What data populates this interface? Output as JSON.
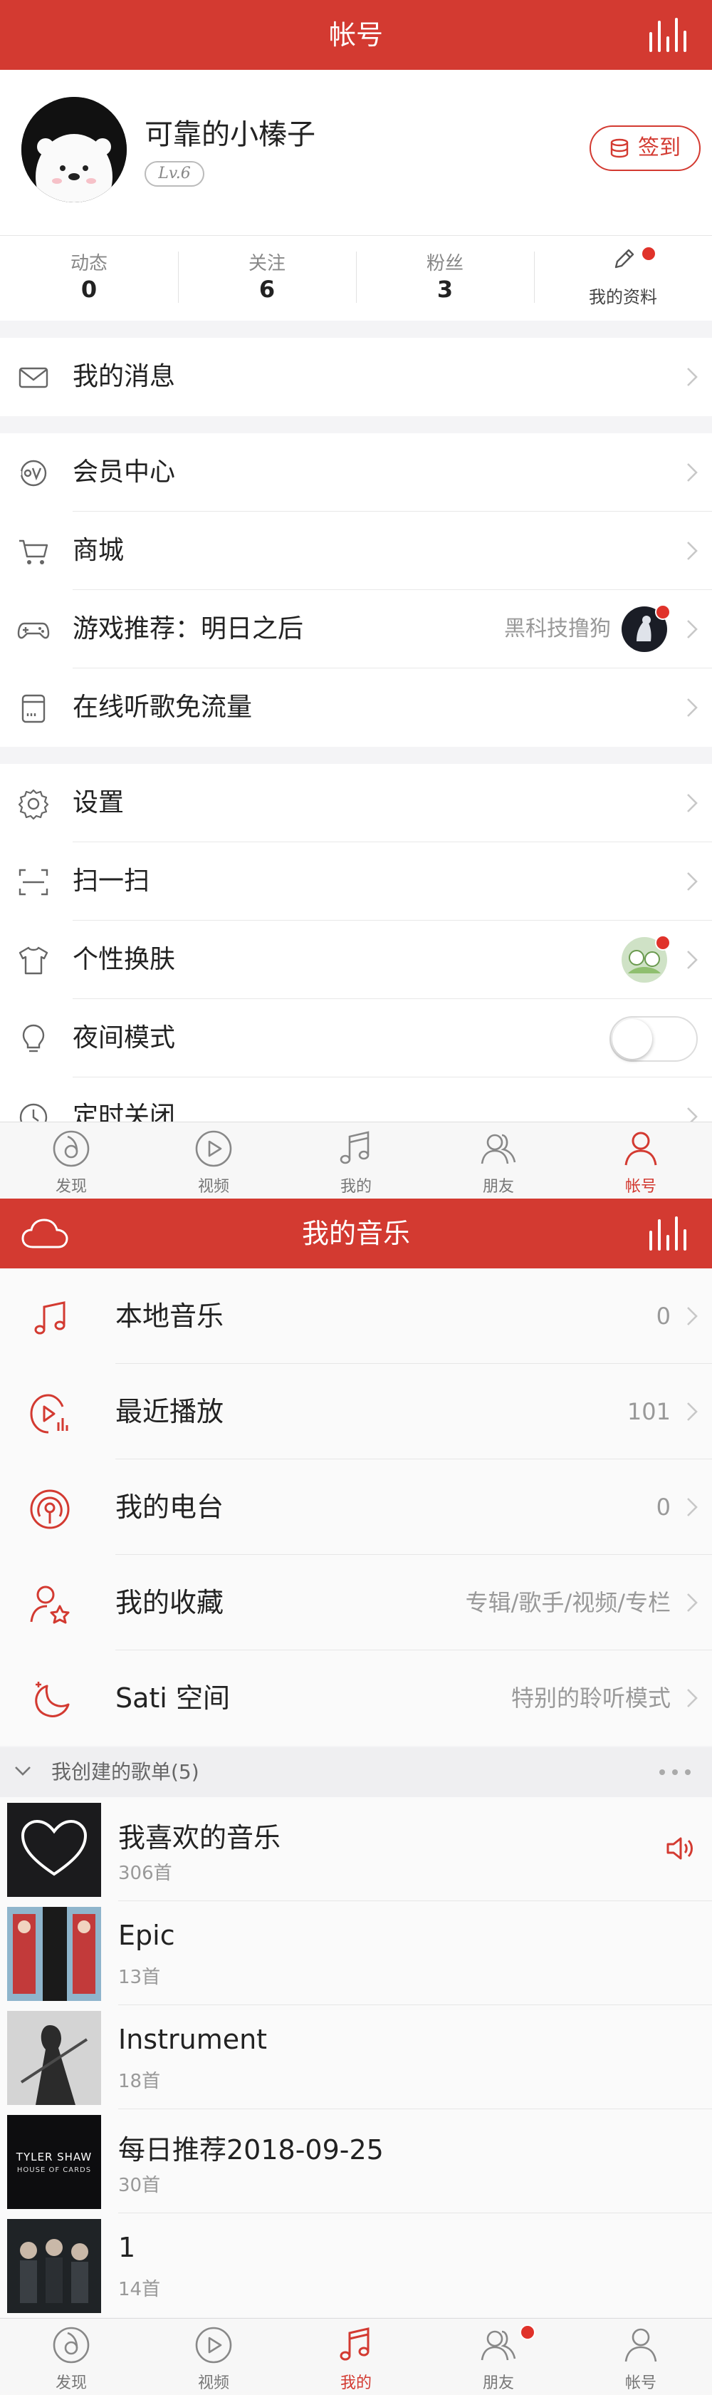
{
  "account": {
    "header": {
      "title": "帐号"
    },
    "profile": {
      "username": "可靠的小榛子",
      "level": "Lv.6",
      "signin_label": "签到"
    },
    "stats": [
      {
        "label": "动态",
        "value": "0"
      },
      {
        "label": "关注",
        "value": "6"
      },
      {
        "label": "粉丝",
        "value": "3"
      },
      {
        "label": "我的资料"
      }
    ],
    "group1": [
      {
        "label": "我的消息",
        "icon": "mail-icon"
      }
    ],
    "group2": [
      {
        "label": "会员中心",
        "icon": "vip-icon"
      },
      {
        "label": "商城",
        "icon": "cart-icon"
      },
      {
        "label": "游戏推荐：明日之后",
        "sub": "黑科技撸狗",
        "icon": "gamepad-icon"
      },
      {
        "label": "在线听歌免流量",
        "icon": "sim-card-icon"
      }
    ],
    "group3": [
      {
        "label": "设置",
        "icon": "gear-icon"
      },
      {
        "label": "扫一扫",
        "icon": "scan-icon"
      },
      {
        "label": "个性换肤",
        "icon": "tshirt-icon"
      },
      {
        "label": "夜间模式",
        "icon": "bulb-icon",
        "toggle": false
      },
      {
        "label": "定时关闭",
        "icon": "clock-icon"
      }
    ]
  },
  "tabs": [
    {
      "label": "发现",
      "icon": "discover-icon"
    },
    {
      "label": "视频",
      "icon": "video-icon"
    },
    {
      "label": "我的",
      "icon": "music-note-icon"
    },
    {
      "label": "朋友",
      "icon": "friends-icon"
    },
    {
      "label": "帐号",
      "icon": "user-icon"
    }
  ],
  "music": {
    "header": {
      "title": "我的音乐"
    },
    "rows": [
      {
        "label": "本地音乐",
        "sub": "0",
        "icon": "music-note-icon"
      },
      {
        "label": "最近播放",
        "sub": "101",
        "icon": "recent-play-icon"
      },
      {
        "label": "我的电台",
        "sub": "0",
        "icon": "radio-icon"
      },
      {
        "label": "我的收藏",
        "sub": "专辑/歌手/视频/专栏",
        "icon": "favorite-icon"
      },
      {
        "label": "Sati 空间",
        "sub": "特别的聆听模式",
        "icon": "moon-icon"
      }
    ],
    "section_title": "我创建的歌单(5)",
    "playlists": [
      {
        "name": "我喜欢的音乐",
        "count": "306首"
      },
      {
        "name": "Epic",
        "count": "13首"
      },
      {
        "name": "Instrument",
        "count": "18首"
      },
      {
        "name": "每日推荐2018-09-25",
        "count": "30首",
        "cover_text": "TYLER SHAW",
        "cover_sub": "HOUSE OF CARDS"
      },
      {
        "name": "1",
        "count": "14首"
      }
    ]
  },
  "colors": {
    "brand": "#d33a31",
    "badge": "#e0322a"
  }
}
